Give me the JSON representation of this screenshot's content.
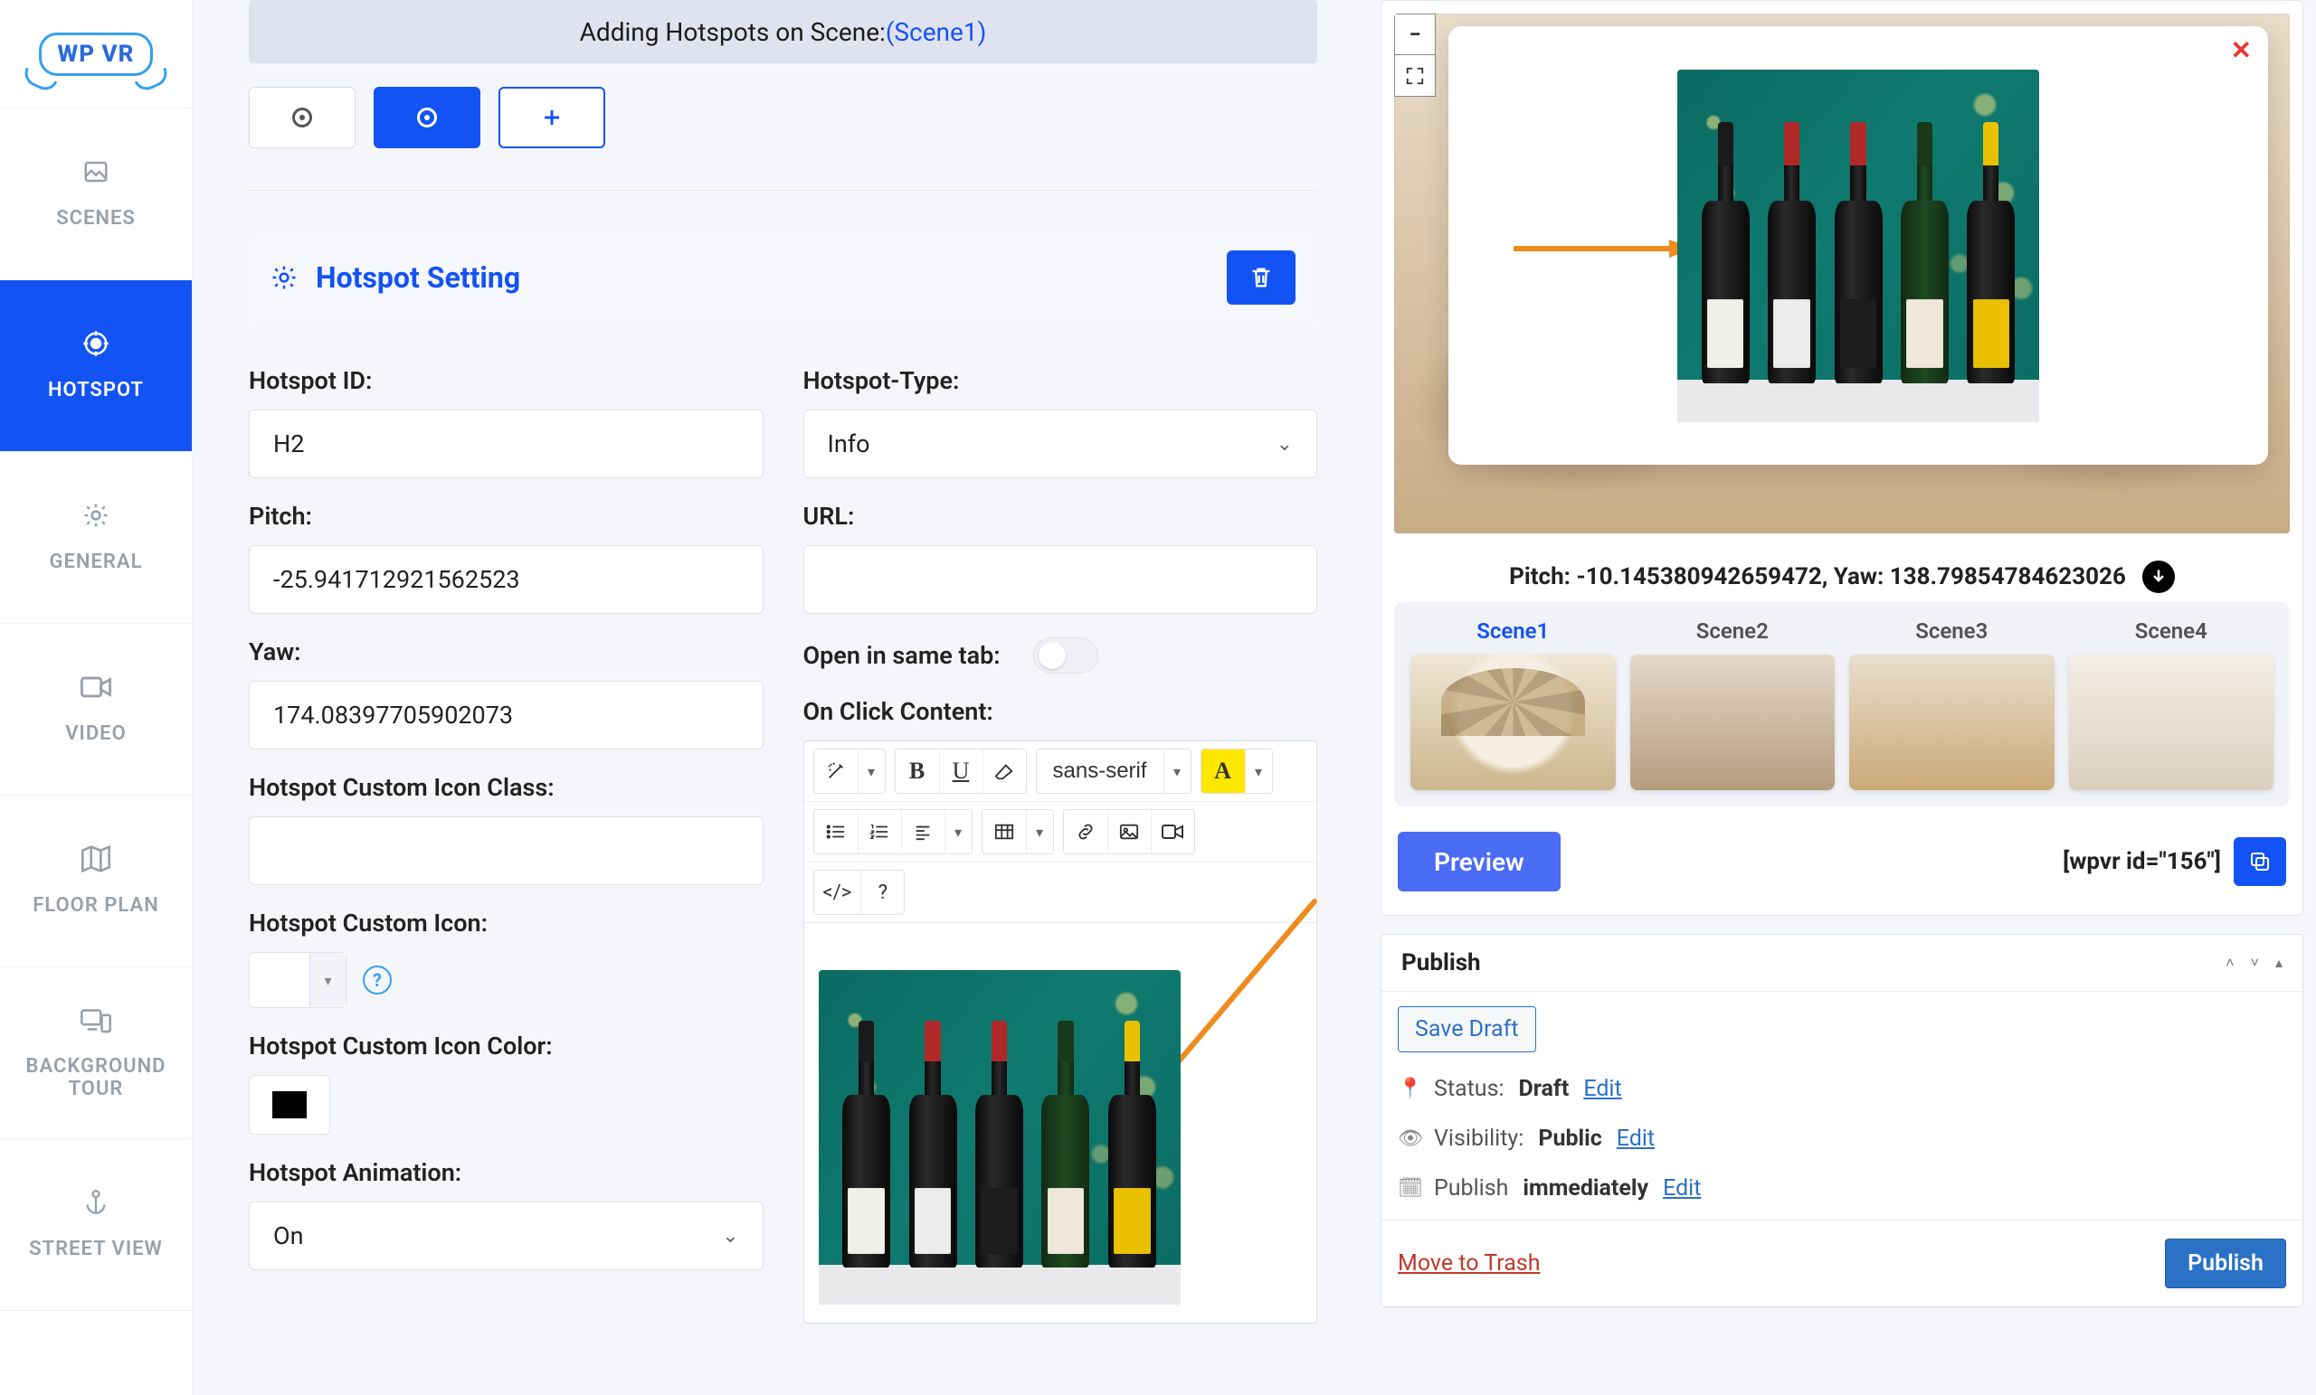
{
  "brand": {
    "name": "WP VR"
  },
  "sidebar": {
    "items": [
      {
        "label": "SCENES"
      },
      {
        "label": "HOTSPOT"
      },
      {
        "label": "GENERAL"
      },
      {
        "label": "VIDEO"
      },
      {
        "label": "FLOOR PLAN"
      },
      {
        "label": "BACKGROUND TOUR"
      },
      {
        "label": "STREET VIEW"
      }
    ]
  },
  "banner": {
    "prefix": "Adding Hotspots on Scene: ",
    "scene_link": "(Scene1)"
  },
  "section": {
    "title": "Hotspot Setting"
  },
  "fields": {
    "hotspot_id": {
      "label": "Hotspot ID:",
      "value": "H2"
    },
    "pitch": {
      "label": "Pitch:",
      "value": "-25.941712921562523"
    },
    "yaw": {
      "label": "Yaw:",
      "value": "174.08397705902073"
    },
    "icon_class": {
      "label": "Hotspot Custom Icon Class:",
      "value": ""
    },
    "custom_icon": {
      "label": "Hotspot Custom Icon:"
    },
    "icon_color": {
      "label": "Hotspot Custom Icon Color:",
      "value": "#000000"
    },
    "animation": {
      "label": "Hotspot Animation:",
      "value": "On"
    },
    "type": {
      "label": "Hotspot-Type:",
      "value": "Info"
    },
    "url": {
      "label": "URL:",
      "value": ""
    },
    "same_tab": {
      "label": "Open in same tab:",
      "value": false
    },
    "occ": {
      "label": "On Click Content:"
    }
  },
  "rte": {
    "font": "sans-serif",
    "code_btn": "</>",
    "help_btn": "?"
  },
  "preview": {
    "coords_label": "Pitch: -10.145380942659472, Yaw: 138.79854784623026",
    "scenes": [
      {
        "name": "Scene1"
      },
      {
        "name": "Scene2"
      },
      {
        "name": "Scene3"
      },
      {
        "name": "Scene4"
      }
    ],
    "preview_btn": "Preview",
    "shortcode": "[wpvr id=\"156\"]"
  },
  "publish": {
    "title": "Publish",
    "save_draft": "Save Draft",
    "status_k": "Status:",
    "status_v": "Draft",
    "edit": "Edit",
    "visibility_k": "Visibility:",
    "visibility_v": "Public",
    "schedule_k": "Publish",
    "schedule_v": "immediately",
    "trash": "Move to Trash",
    "publish_btn": "Publish"
  }
}
